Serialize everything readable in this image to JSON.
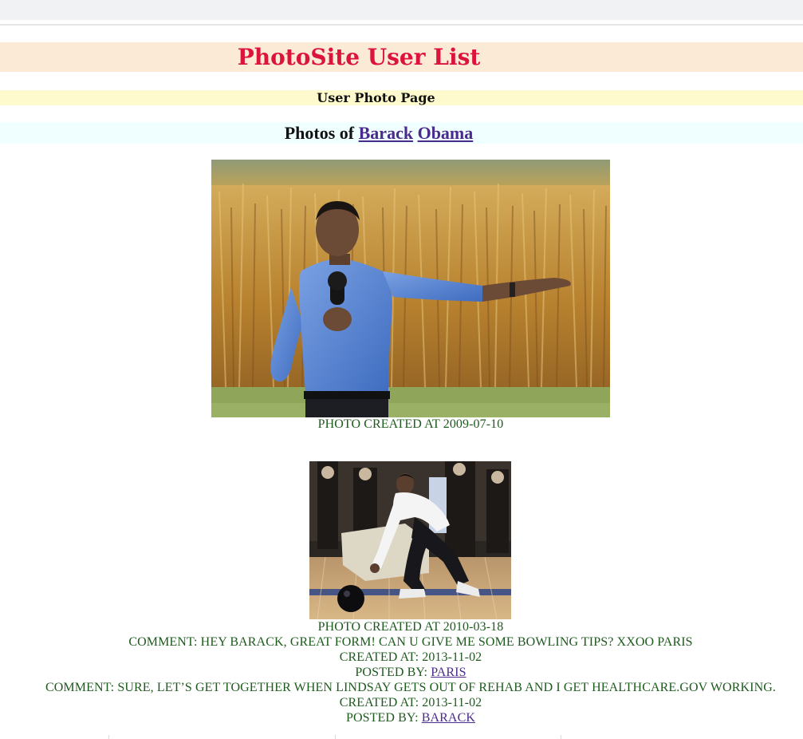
{
  "header": {
    "site_title": "PhotoSite User List",
    "subtitle": "User Photo Page",
    "photos_of_label": "Photos of",
    "first_name": "Barack",
    "last_name": "Obama"
  },
  "photos": [
    {
      "created_label": "Photo created at 2009-07-10",
      "comments": []
    },
    {
      "created_label": "Photo created at 2010-03-18",
      "comments": [
        {
          "text": "Comment: Hey Barack, great form! Can u give me some bowling tips? xxoo Paris",
          "created": "Created at: 2013-11-02",
          "posted_by_label": "Posted by:",
          "author": "Paris"
        },
        {
          "text": "Comment: Sure, let’s get together when Lindsay gets out of rehab and I get healthcare.gov working.",
          "created": "Created at: 2013-11-02",
          "posted_by_label": "Posted by:",
          "author": "Barack"
        }
      ]
    }
  ],
  "colors": {
    "site_title": "#dc143c",
    "site_band": "#fbead6",
    "subtitle_band": "#fffacd",
    "photos_band": "#f0ffff",
    "meta_text": "#1e5a1e",
    "link": "#4b2a8e"
  }
}
